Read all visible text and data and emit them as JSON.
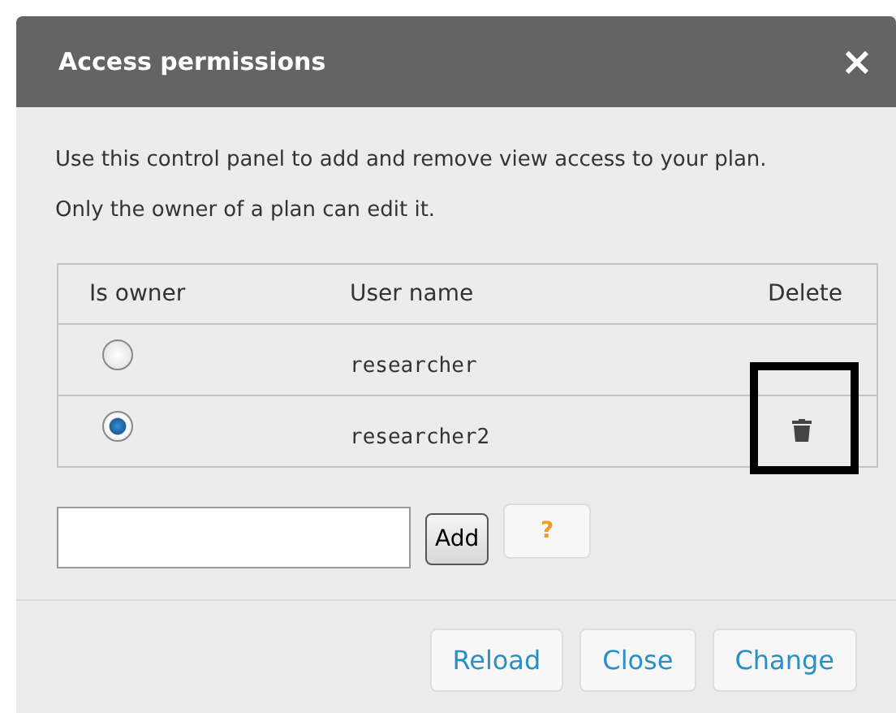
{
  "dialog": {
    "title": "Access permissions",
    "close": "×",
    "description": "Use this control panel to add and remove view access to your plan. Only the owner of a plan can edit it."
  },
  "table": {
    "columns": [
      "Is owner",
      "User name",
      "Delete"
    ],
    "rows": [
      {
        "owner_selected": false,
        "user_name": "researcher",
        "deletable": false,
        "highlighted": false
      },
      {
        "owner_selected": true,
        "user_name": "researcher2",
        "deletable": true,
        "highlighted": true
      }
    ]
  },
  "add_form": {
    "button": "Add",
    "help": "?"
  },
  "buttons": [
    "Reload",
    "Close",
    "Change"
  ]
}
